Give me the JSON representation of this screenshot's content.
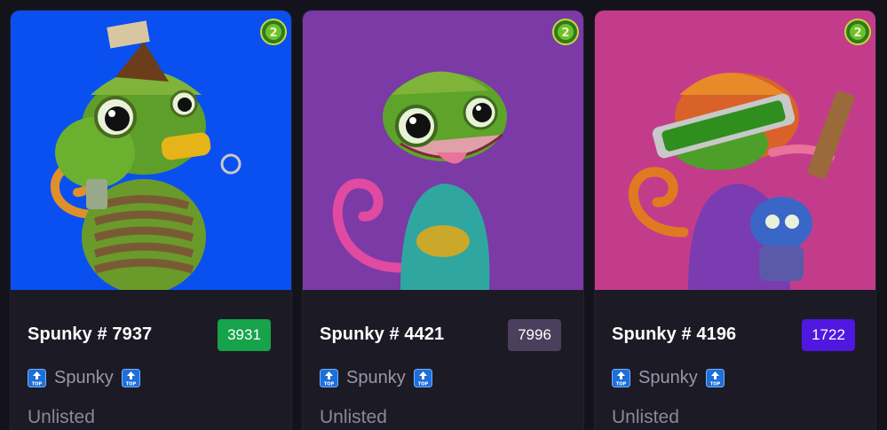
{
  "cards": [
    {
      "title": "Spunky # 7937",
      "rank": "3931",
      "rank_color": "#16a34a",
      "bg_color": "#0a50f0",
      "collection": "Spunky",
      "status": "Unlisted",
      "badge_icon": "top-arrow-icon",
      "coin_icon": "green-coin-icon"
    },
    {
      "title": "Spunky # 4421",
      "rank": "7996",
      "rank_color": "#4a3f5c",
      "bg_color": "#7b3aa6",
      "collection": "Spunky",
      "status": "Unlisted",
      "badge_icon": "top-arrow-icon",
      "coin_icon": "green-coin-icon"
    },
    {
      "title": "Spunky # 4196",
      "rank": "1722",
      "rank_color": "#4f17e0",
      "bg_color": "#c33c8c",
      "collection": "Spunky",
      "status": "Unlisted",
      "badge_icon": "top-arrow-icon",
      "coin_icon": "green-coin-icon"
    }
  ]
}
